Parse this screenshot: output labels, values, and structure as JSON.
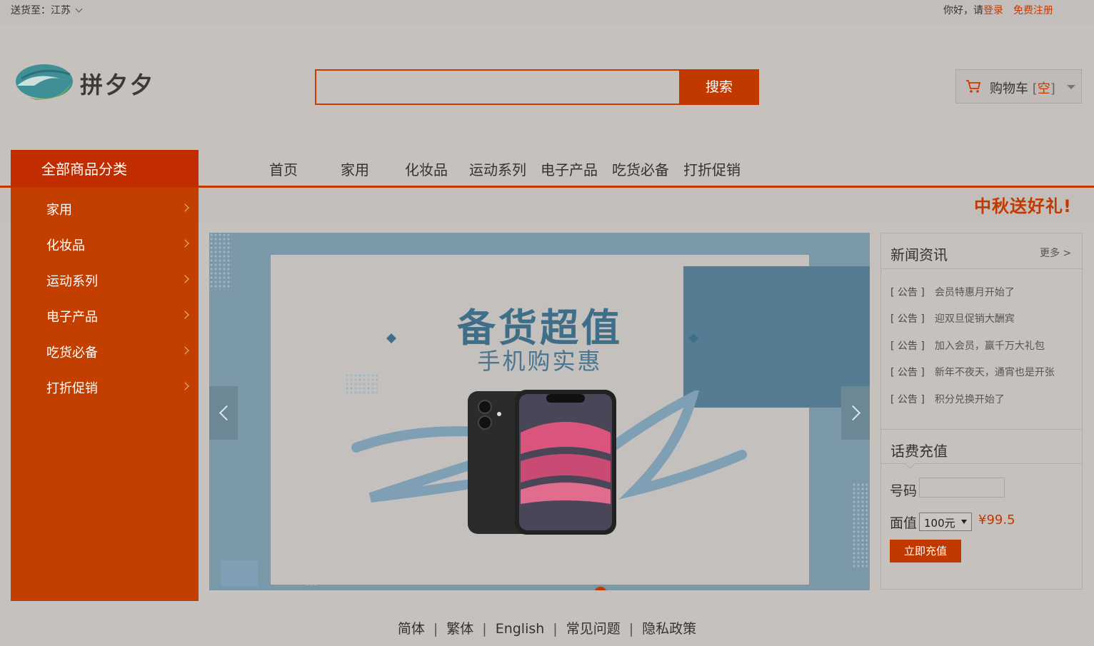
{
  "topbar": {
    "ship_to": "送货至：江苏",
    "greeting": "你好，请",
    "login": "登录",
    "register": "免费注册"
  },
  "logo": {
    "text": "拼夕夕"
  },
  "search": {
    "value": "",
    "button": "搜索"
  },
  "cart": {
    "label": "购物车",
    "open_bracket": "[",
    "status": "空",
    "close_bracket": "]"
  },
  "nav": {
    "all_categories": "全部商品分类",
    "links": [
      "首页",
      "家用",
      "化妆品",
      "运动系列",
      "电子产品",
      "吃货必备",
      "打折促销"
    ],
    "promo": "中秋送好礼!"
  },
  "categories": [
    "家用",
    "化妆品",
    "运动系列",
    "电子产品",
    "吃货必备",
    "打折促销"
  ],
  "banner": {
    "title": "备货超值",
    "subtitle": "手机购实惠"
  },
  "news": {
    "heading": "新闻资讯",
    "more": "更多 >",
    "items": [
      {
        "tag": "[ 公告 ]",
        "text": "会员特惠月开始了"
      },
      {
        "tag": "[ 公告 ]",
        "text": "迎双旦促销大酬宾"
      },
      {
        "tag": "[ 公告 ]",
        "text": "加入会员，赢千万大礼包"
      },
      {
        "tag": "[ 公告 ]",
        "text": "新年不夜天，通宵也是开张"
      },
      {
        "tag": "[ 公告 ]",
        "text": "积分兑换开始了"
      }
    ]
  },
  "recharge": {
    "heading": "话费充值",
    "number_label": "号码",
    "number_value": "",
    "amount_label": "面值",
    "amount_selected": "100元",
    "price": "¥99.5",
    "button": "立即充值"
  },
  "footer": {
    "links": [
      "简体",
      "繁体",
      "English",
      "常见问题",
      "隐私政策"
    ],
    "separator": "|"
  },
  "colors": {
    "accent": "#c23900",
    "category_bg": "#c33f00",
    "page_bg": "#c6c1bd"
  }
}
